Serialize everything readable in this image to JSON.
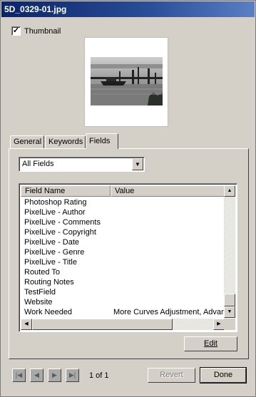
{
  "window": {
    "title": "5D_0329-01.jpg"
  },
  "thumbnail": {
    "label": "Thumbnail",
    "checked": true
  },
  "tabs": [
    {
      "label": "General"
    },
    {
      "label": "Keywords"
    },
    {
      "label": "Fields",
      "active": true
    }
  ],
  "fields_filter": {
    "value": "All Fields"
  },
  "table": {
    "columns": [
      "Field Name",
      "Value"
    ],
    "rows": [
      {
        "name": "Photoshop Rating",
        "value": ""
      },
      {
        "name": "PixelLive - Author",
        "value": ""
      },
      {
        "name": "PixelLive - Comments",
        "value": ""
      },
      {
        "name": "PixelLive - Copyright",
        "value": ""
      },
      {
        "name": "PixelLive - Date",
        "value": ""
      },
      {
        "name": "PixelLive - Genre",
        "value": ""
      },
      {
        "name": "PixelLive - Title",
        "value": ""
      },
      {
        "name": "Routed To",
        "value": ""
      },
      {
        "name": "Routing Notes",
        "value": ""
      },
      {
        "name": "TestField",
        "value": ""
      },
      {
        "name": "Website",
        "value": ""
      },
      {
        "name": "Work Needed",
        "value": "More Curves Adjustment, Advan"
      }
    ]
  },
  "buttons": {
    "edit": "Edit",
    "revert": "Revert",
    "done": "Done"
  },
  "pager": {
    "text": "1 of 1"
  },
  "icons": {
    "first": "first-icon",
    "prev": "prev-icon",
    "next": "next-icon",
    "last": "last-icon",
    "check": "check-icon",
    "dropdown": "chevron-down-icon"
  }
}
